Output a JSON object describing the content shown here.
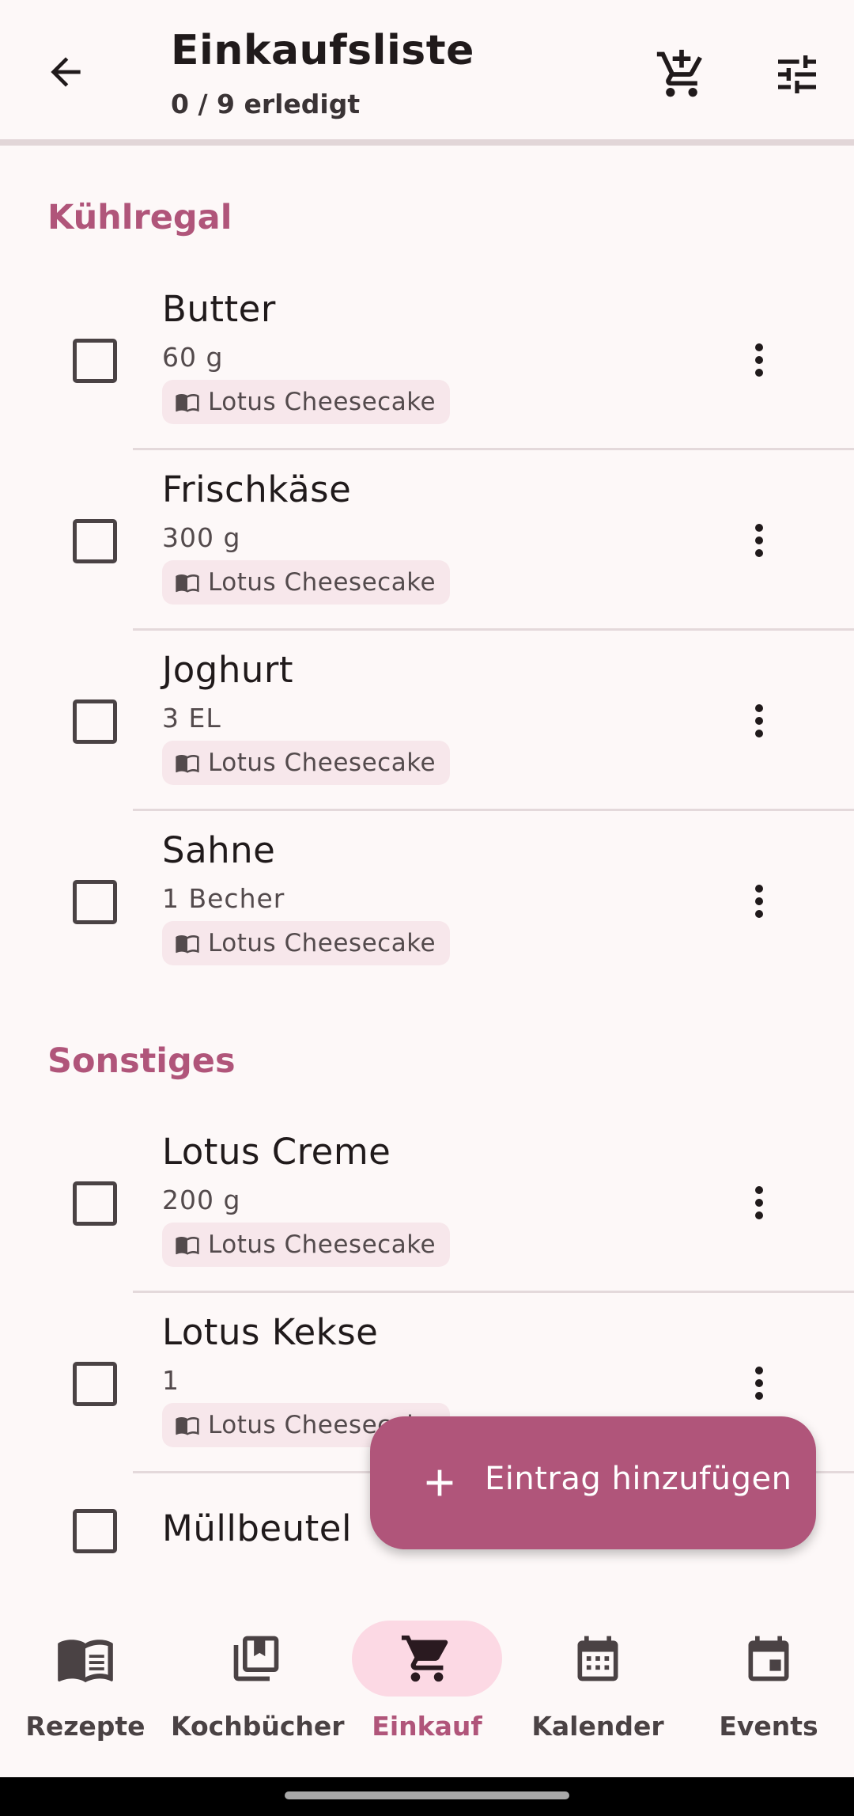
{
  "appbar": {
    "title": "Einkaufsliste",
    "subtitle": "0 / 9 erledigt",
    "back_icon": "arrow-back-icon",
    "cart_add_icon": "cart-add-icon",
    "filter_icon": "tune-icon"
  },
  "sections": [
    {
      "title": "Kühlregal",
      "items": [
        {
          "name": "Butter",
          "qty": "60 g",
          "recipe": "Lotus Cheesecake",
          "checked": false
        },
        {
          "name": "Frischkäse",
          "qty": "300 g",
          "recipe": "Lotus Cheesecake",
          "checked": false
        },
        {
          "name": "Joghurt",
          "qty": "3 EL",
          "recipe": "Lotus Cheesecake",
          "checked": false
        },
        {
          "name": "Sahne",
          "qty": "1 Becher",
          "recipe": "Lotus Cheesecake",
          "checked": false
        }
      ]
    },
    {
      "title": "Sonstiges",
      "items": [
        {
          "name": "Lotus Creme",
          "qty": "200 g",
          "recipe": "Lotus Cheesecake",
          "checked": false
        },
        {
          "name": "Lotus Kekse",
          "qty": "1",
          "recipe": "Lotus Cheesecake",
          "checked": false
        },
        {
          "name": "Müllbeutel",
          "qty": "",
          "recipe": "",
          "checked": false
        }
      ]
    }
  ],
  "fab": {
    "label": "Eintrag hinzufügen",
    "icon": "plus-icon"
  },
  "nav": {
    "items": [
      {
        "label": "Rezepte",
        "icon": "book-open-icon",
        "active": false
      },
      {
        "label": "Kochbücher",
        "icon": "cookbooks-icon",
        "active": false
      },
      {
        "label": "Einkauf",
        "icon": "cart-icon",
        "active": true
      },
      {
        "label": "Kalender",
        "icon": "calendar-icon",
        "active": false
      },
      {
        "label": "Events",
        "icon": "event-icon",
        "active": false
      }
    ]
  },
  "colors": {
    "accent": "#b0557a",
    "background": "#fdf8f8",
    "chip": "#f7e7eb",
    "nav_active": "#fcd9e4"
  }
}
